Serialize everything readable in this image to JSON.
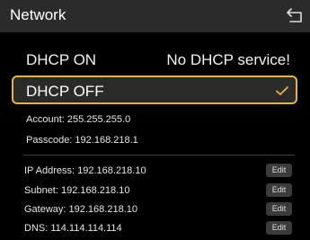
{
  "header": {
    "title": "Network"
  },
  "dhcp": {
    "on_label": "DHCP ON",
    "status": "No DHCP service!",
    "off_label": "DHCP OFF"
  },
  "info": {
    "account": "Account: 255.255.255.0",
    "passcode": "Passcode: 192.168.218.1"
  },
  "fields": {
    "ip": "IP Address: 192.168.218.10",
    "subnet": "Subnet: 192.168.218.10",
    "gateway": "Gateway: 192.168.218.10",
    "dns": "DNS: 114.114.114.114",
    "edit_label": "Edit"
  },
  "colors": {
    "accent": "#e8b33a",
    "header_bg": "#2b2b2b"
  },
  "icons": {
    "back": "back-arrow-icon",
    "check": "check-icon"
  }
}
